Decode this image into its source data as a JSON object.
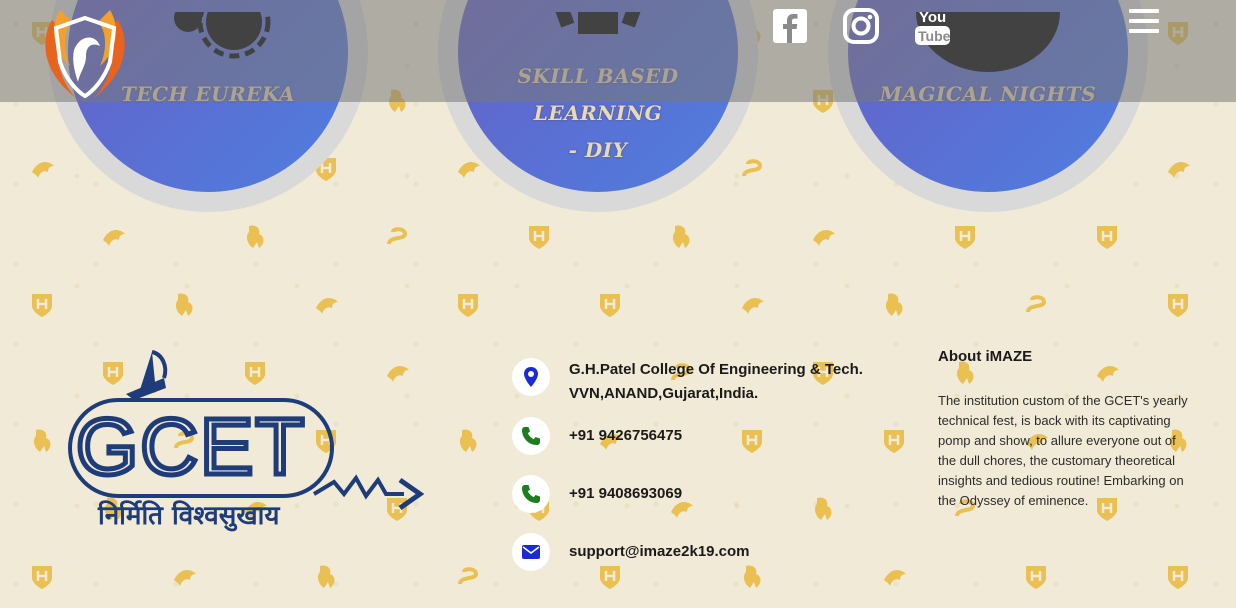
{
  "events": [
    {
      "label_line1": "TECH EUREKA",
      "label_line2": ""
    },
    {
      "label_line1": "SKILL BASED LEARNING",
      "label_line2": "- DIY"
    },
    {
      "label_line1": "MAGICAL NIGHTS",
      "label_line2": ""
    }
  ],
  "topbar": {
    "logo_icon": "phoenix-logo-icon",
    "social": [
      {
        "name": "facebook-icon",
        "label": "f"
      },
      {
        "name": "instagram-icon"
      },
      {
        "name": "youtube-icon",
        "label_top": "You",
        "label_bottom": "Tube"
      }
    ],
    "menu_icon": "hamburger-menu-icon"
  },
  "footer": {
    "college_logo": {
      "text": "GCET",
      "tagline": "निर्मिति विश्वसुखाय"
    },
    "contacts": [
      {
        "icon": "location-pin-icon",
        "line1": "G.H.Patel College Of Engineering & Tech.",
        "line2": "VVN,ANAND,Gujarat,India."
      },
      {
        "icon": "phone-icon",
        "line1": "+91 9426756475"
      },
      {
        "icon": "phone-icon",
        "line1": "+91 9408693069"
      },
      {
        "icon": "mail-icon",
        "line1": "support@imaze2k19.com"
      }
    ],
    "about": {
      "title": "About iMAZE",
      "body": "The institution custom of the GCET's yearly technical fest, is back with its captivating pomp and show, to allure everyone out of the dull chores, the customary theoretical insights and tedious routine! Embarking on the Odyssey of eminence."
    }
  },
  "colors": {
    "background": "#f1ead7",
    "circle_start": "#6a5bc2",
    "circle_end": "#4e7fe0",
    "pattern_gold": "#e8b93a",
    "navy": "#1f3c7a",
    "pin_blue": "#1a2ad8",
    "phone_green": "#1d7d1d"
  }
}
